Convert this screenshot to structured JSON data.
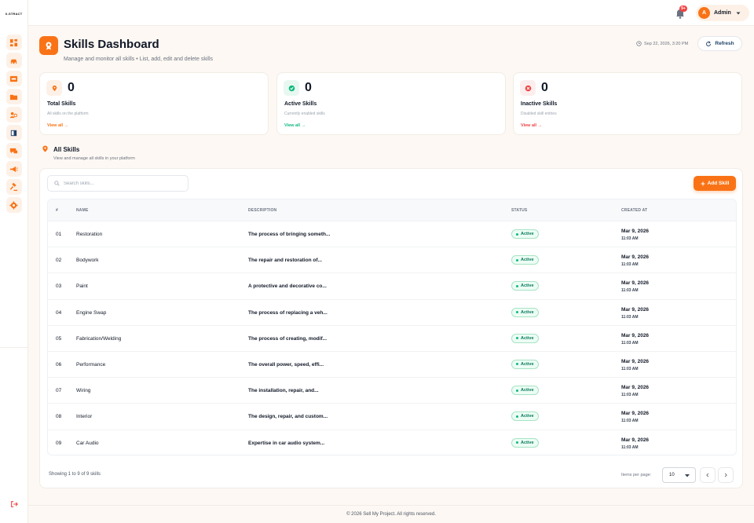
{
  "sidebar": {
    "logo_text": "X-STRACT",
    "items": [
      {
        "icon": "dashboard-icon"
      },
      {
        "icon": "car-icon"
      },
      {
        "icon": "tool-box-icon"
      },
      {
        "icon": "folder-icon"
      },
      {
        "icon": "users-icon"
      },
      {
        "icon": "book-icon"
      },
      {
        "icon": "chat-icon"
      },
      {
        "icon": "megaphone-icon"
      },
      {
        "icon": "gavel-icon"
      },
      {
        "icon": "settings-icon"
      }
    ],
    "logout_icon": "logout-icon"
  },
  "topbar": {
    "notification_badge": "9+",
    "user_initial": "A",
    "user_name": "Admin"
  },
  "header": {
    "title": "Skills Dashboard",
    "subtitle": "Manage and monitor all skills • List, add, edit and delete skills",
    "timestamp": "Sep 22, 2026, 3:20 PM",
    "refresh_label": "Refresh"
  },
  "stats": [
    {
      "value": "0",
      "label": "Total Skills",
      "desc": "All skills on the platform",
      "link": "View all →",
      "accent": "#f97316"
    },
    {
      "value": "0",
      "label": "Active Skills",
      "desc": "Currently enabled skills",
      "link": "View all →",
      "accent": "#10b981"
    },
    {
      "value": "0",
      "label": "Inactive Skills",
      "desc": "Disabled skill entries",
      "link": "View all →",
      "accent": "#ef4444"
    }
  ],
  "section": {
    "title": "All Skills",
    "subtitle": "View and manage all skills in your platform"
  },
  "search": {
    "placeholder": "Search skills..."
  },
  "add_button_label": "Add Skill",
  "table": {
    "headers": [
      "#",
      "NAME",
      "DESCRIPTION",
      "STATUS",
      "CREATED AT"
    ],
    "rows": [
      {
        "num": "01",
        "name": "Restoration",
        "desc": "The process of bringing someth...",
        "status": "Active",
        "date": "Mar 9, 2026",
        "time": "11:03 AM"
      },
      {
        "num": "02",
        "name": "Bodywork",
        "desc": "The repair and restoration of...",
        "status": "Active",
        "date": "Mar 9, 2026",
        "time": "11:03 AM"
      },
      {
        "num": "03",
        "name": "Paint",
        "desc": "A protective and decorative co...",
        "status": "Active",
        "date": "Mar 9, 2026",
        "time": "11:03 AM"
      },
      {
        "num": "04",
        "name": "Engine Swap",
        "desc": "The process of replacing a veh...",
        "status": "Active",
        "date": "Mar 9, 2026",
        "time": "11:03 AM"
      },
      {
        "num": "05",
        "name": "Fabrication/Welding",
        "desc": "The process of creating, modif...",
        "status": "Active",
        "date": "Mar 9, 2026",
        "time": "11:03 AM"
      },
      {
        "num": "06",
        "name": "Performance",
        "desc": "The overall power, speed, effi...",
        "status": "Active",
        "date": "Mar 9, 2026",
        "time": "11:03 AM"
      },
      {
        "num": "07",
        "name": "Wiring",
        "desc": "The installation, repair, and...",
        "status": "Active",
        "date": "Mar 9, 2026",
        "time": "11:03 AM"
      },
      {
        "num": "08",
        "name": "Interior",
        "desc": "The design, repair, and custom...",
        "status": "Active",
        "date": "Mar 9, 2026",
        "time": "11:03 AM"
      },
      {
        "num": "09",
        "name": "Car Audio",
        "desc": "Expertise in car audio system...",
        "status": "Active",
        "date": "Mar 9, 2026",
        "time": "11:03 AM"
      }
    ]
  },
  "pagination": {
    "showing": "Showing 1 to 9 of 9 skills",
    "items_per_page_label": "Items per page:",
    "items_per_page_value": "10"
  },
  "footer": {
    "copyright": "© 2026 Sell My Project. All rights reserved."
  },
  "colors": {
    "accent": "#f97316",
    "success": "#10b981",
    "danger": "#ef4444"
  }
}
